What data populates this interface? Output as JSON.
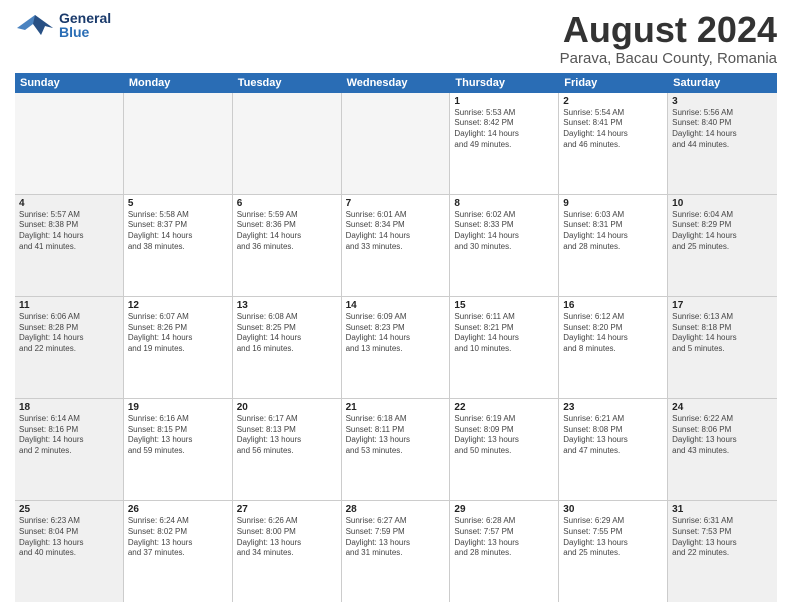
{
  "header": {
    "logo_general": "General",
    "logo_blue": "Blue",
    "main_title": "August 2024",
    "subtitle": "Parava, Bacau County, Romania"
  },
  "calendar": {
    "days_of_week": [
      "Sunday",
      "Monday",
      "Tuesday",
      "Wednesday",
      "Thursday",
      "Friday",
      "Saturday"
    ],
    "rows": [
      [
        {
          "day": "",
          "empty": true
        },
        {
          "day": "",
          "empty": true
        },
        {
          "day": "",
          "empty": true
        },
        {
          "day": "",
          "empty": true
        },
        {
          "day": "1",
          "lines": [
            "Sunrise: 5:53 AM",
            "Sunset: 8:42 PM",
            "Daylight: 14 hours",
            "and 49 minutes."
          ]
        },
        {
          "day": "2",
          "lines": [
            "Sunrise: 5:54 AM",
            "Sunset: 8:41 PM",
            "Daylight: 14 hours",
            "and 46 minutes."
          ]
        },
        {
          "day": "3",
          "lines": [
            "Sunrise: 5:56 AM",
            "Sunset: 8:40 PM",
            "Daylight: 14 hours",
            "and 44 minutes."
          ]
        }
      ],
      [
        {
          "day": "4",
          "lines": [
            "Sunrise: 5:57 AM",
            "Sunset: 8:38 PM",
            "Daylight: 14 hours",
            "and 41 minutes."
          ]
        },
        {
          "day": "5",
          "lines": [
            "Sunrise: 5:58 AM",
            "Sunset: 8:37 PM",
            "Daylight: 14 hours",
            "and 38 minutes."
          ]
        },
        {
          "day": "6",
          "lines": [
            "Sunrise: 5:59 AM",
            "Sunset: 8:36 PM",
            "Daylight: 14 hours",
            "and 36 minutes."
          ]
        },
        {
          "day": "7",
          "lines": [
            "Sunrise: 6:01 AM",
            "Sunset: 8:34 PM",
            "Daylight: 14 hours",
            "and 33 minutes."
          ]
        },
        {
          "day": "8",
          "lines": [
            "Sunrise: 6:02 AM",
            "Sunset: 8:33 PM",
            "Daylight: 14 hours",
            "and 30 minutes."
          ]
        },
        {
          "day": "9",
          "lines": [
            "Sunrise: 6:03 AM",
            "Sunset: 8:31 PM",
            "Daylight: 14 hours",
            "and 28 minutes."
          ]
        },
        {
          "day": "10",
          "lines": [
            "Sunrise: 6:04 AM",
            "Sunset: 8:29 PM",
            "Daylight: 14 hours",
            "and 25 minutes."
          ]
        }
      ],
      [
        {
          "day": "11",
          "lines": [
            "Sunrise: 6:06 AM",
            "Sunset: 8:28 PM",
            "Daylight: 14 hours",
            "and 22 minutes."
          ]
        },
        {
          "day": "12",
          "lines": [
            "Sunrise: 6:07 AM",
            "Sunset: 8:26 PM",
            "Daylight: 14 hours",
            "and 19 minutes."
          ]
        },
        {
          "day": "13",
          "lines": [
            "Sunrise: 6:08 AM",
            "Sunset: 8:25 PM",
            "Daylight: 14 hours",
            "and 16 minutes."
          ]
        },
        {
          "day": "14",
          "lines": [
            "Sunrise: 6:09 AM",
            "Sunset: 8:23 PM",
            "Daylight: 14 hours",
            "and 13 minutes."
          ]
        },
        {
          "day": "15",
          "lines": [
            "Sunrise: 6:11 AM",
            "Sunset: 8:21 PM",
            "Daylight: 14 hours",
            "and 10 minutes."
          ]
        },
        {
          "day": "16",
          "lines": [
            "Sunrise: 6:12 AM",
            "Sunset: 8:20 PM",
            "Daylight: 14 hours",
            "and 8 minutes."
          ]
        },
        {
          "day": "17",
          "lines": [
            "Sunrise: 6:13 AM",
            "Sunset: 8:18 PM",
            "Daylight: 14 hours",
            "and 5 minutes."
          ]
        }
      ],
      [
        {
          "day": "18",
          "lines": [
            "Sunrise: 6:14 AM",
            "Sunset: 8:16 PM",
            "Daylight: 14 hours",
            "and 2 minutes."
          ]
        },
        {
          "day": "19",
          "lines": [
            "Sunrise: 6:16 AM",
            "Sunset: 8:15 PM",
            "Daylight: 13 hours",
            "and 59 minutes."
          ]
        },
        {
          "day": "20",
          "lines": [
            "Sunrise: 6:17 AM",
            "Sunset: 8:13 PM",
            "Daylight: 13 hours",
            "and 56 minutes."
          ]
        },
        {
          "day": "21",
          "lines": [
            "Sunrise: 6:18 AM",
            "Sunset: 8:11 PM",
            "Daylight: 13 hours",
            "and 53 minutes."
          ]
        },
        {
          "day": "22",
          "lines": [
            "Sunrise: 6:19 AM",
            "Sunset: 8:09 PM",
            "Daylight: 13 hours",
            "and 50 minutes."
          ]
        },
        {
          "day": "23",
          "lines": [
            "Sunrise: 6:21 AM",
            "Sunset: 8:08 PM",
            "Daylight: 13 hours",
            "and 47 minutes."
          ]
        },
        {
          "day": "24",
          "lines": [
            "Sunrise: 6:22 AM",
            "Sunset: 8:06 PM",
            "Daylight: 13 hours",
            "and 43 minutes."
          ]
        }
      ],
      [
        {
          "day": "25",
          "lines": [
            "Sunrise: 6:23 AM",
            "Sunset: 8:04 PM",
            "Daylight: 13 hours",
            "and 40 minutes."
          ]
        },
        {
          "day": "26",
          "lines": [
            "Sunrise: 6:24 AM",
            "Sunset: 8:02 PM",
            "Daylight: 13 hours",
            "and 37 minutes."
          ]
        },
        {
          "day": "27",
          "lines": [
            "Sunrise: 6:26 AM",
            "Sunset: 8:00 PM",
            "Daylight: 13 hours",
            "and 34 minutes."
          ]
        },
        {
          "day": "28",
          "lines": [
            "Sunrise: 6:27 AM",
            "Sunset: 7:59 PM",
            "Daylight: 13 hours",
            "and 31 minutes."
          ]
        },
        {
          "day": "29",
          "lines": [
            "Sunrise: 6:28 AM",
            "Sunset: 7:57 PM",
            "Daylight: 13 hours",
            "and 28 minutes."
          ]
        },
        {
          "day": "30",
          "lines": [
            "Sunrise: 6:29 AM",
            "Sunset: 7:55 PM",
            "Daylight: 13 hours",
            "and 25 minutes."
          ]
        },
        {
          "day": "31",
          "lines": [
            "Sunrise: 6:31 AM",
            "Sunset: 7:53 PM",
            "Daylight: 13 hours",
            "and 22 minutes."
          ]
        }
      ]
    ]
  }
}
